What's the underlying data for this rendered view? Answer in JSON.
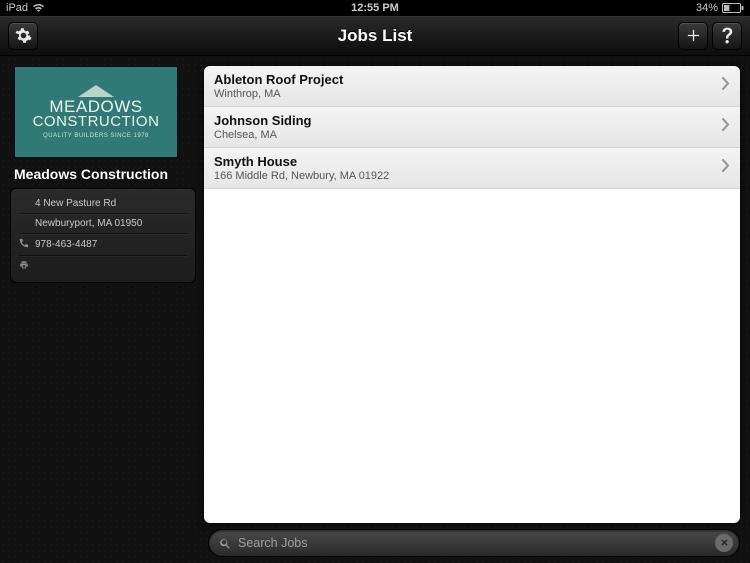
{
  "status_bar": {
    "carrier": "iPad",
    "time": "12:55 PM",
    "battery_text": "34%"
  },
  "nav": {
    "title": "Jobs List"
  },
  "sidebar": {
    "logo": {
      "line1": "MEADOWS",
      "line2": "CONSTRUCTION",
      "tagline": "QUALITY BUILDERS SINCE 1978"
    },
    "company_name": "Meadows Construction",
    "address_line": "4 New Pasture Rd",
    "city_line": "Newburyport, MA 01950",
    "phone": "978-463-4487"
  },
  "jobs": [
    {
      "title": "Ableton Roof Project",
      "subtitle": "Winthrop, MA"
    },
    {
      "title": "Johnson Siding",
      "subtitle": "Chelsea, MA"
    },
    {
      "title": "Smyth House",
      "subtitle": "166 Middle Rd, Newbury, MA 01922"
    }
  ],
  "search": {
    "placeholder": "Search Jobs",
    "value": ""
  }
}
